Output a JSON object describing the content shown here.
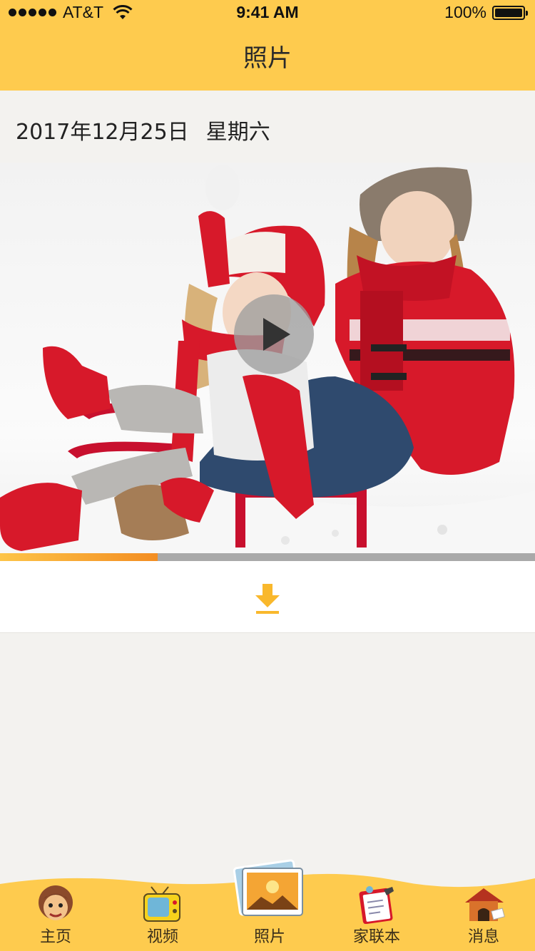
{
  "status_bar": {
    "carrier": "AT&T",
    "time": "9:41 AM",
    "battery": "100%"
  },
  "header": {
    "title": "照片"
  },
  "entry": {
    "date": "2017年12月25日",
    "weekday": "星期六"
  },
  "video": {
    "progress_fraction": 0.295
  },
  "tabs": [
    {
      "label": "主页",
      "icon": "boy-face-icon"
    },
    {
      "label": "视频",
      "icon": "tv-icon"
    },
    {
      "label": "照片",
      "icon": "photos-icon",
      "active": true
    },
    {
      "label": "家联本",
      "icon": "notebook-icon"
    },
    {
      "label": "消息",
      "icon": "doghouse-icon"
    }
  ],
  "colors": {
    "header": "#fecb4e",
    "accent": "#f9b82c",
    "progress_fill": "#f38d22",
    "page_background": "#f3f2ef"
  }
}
